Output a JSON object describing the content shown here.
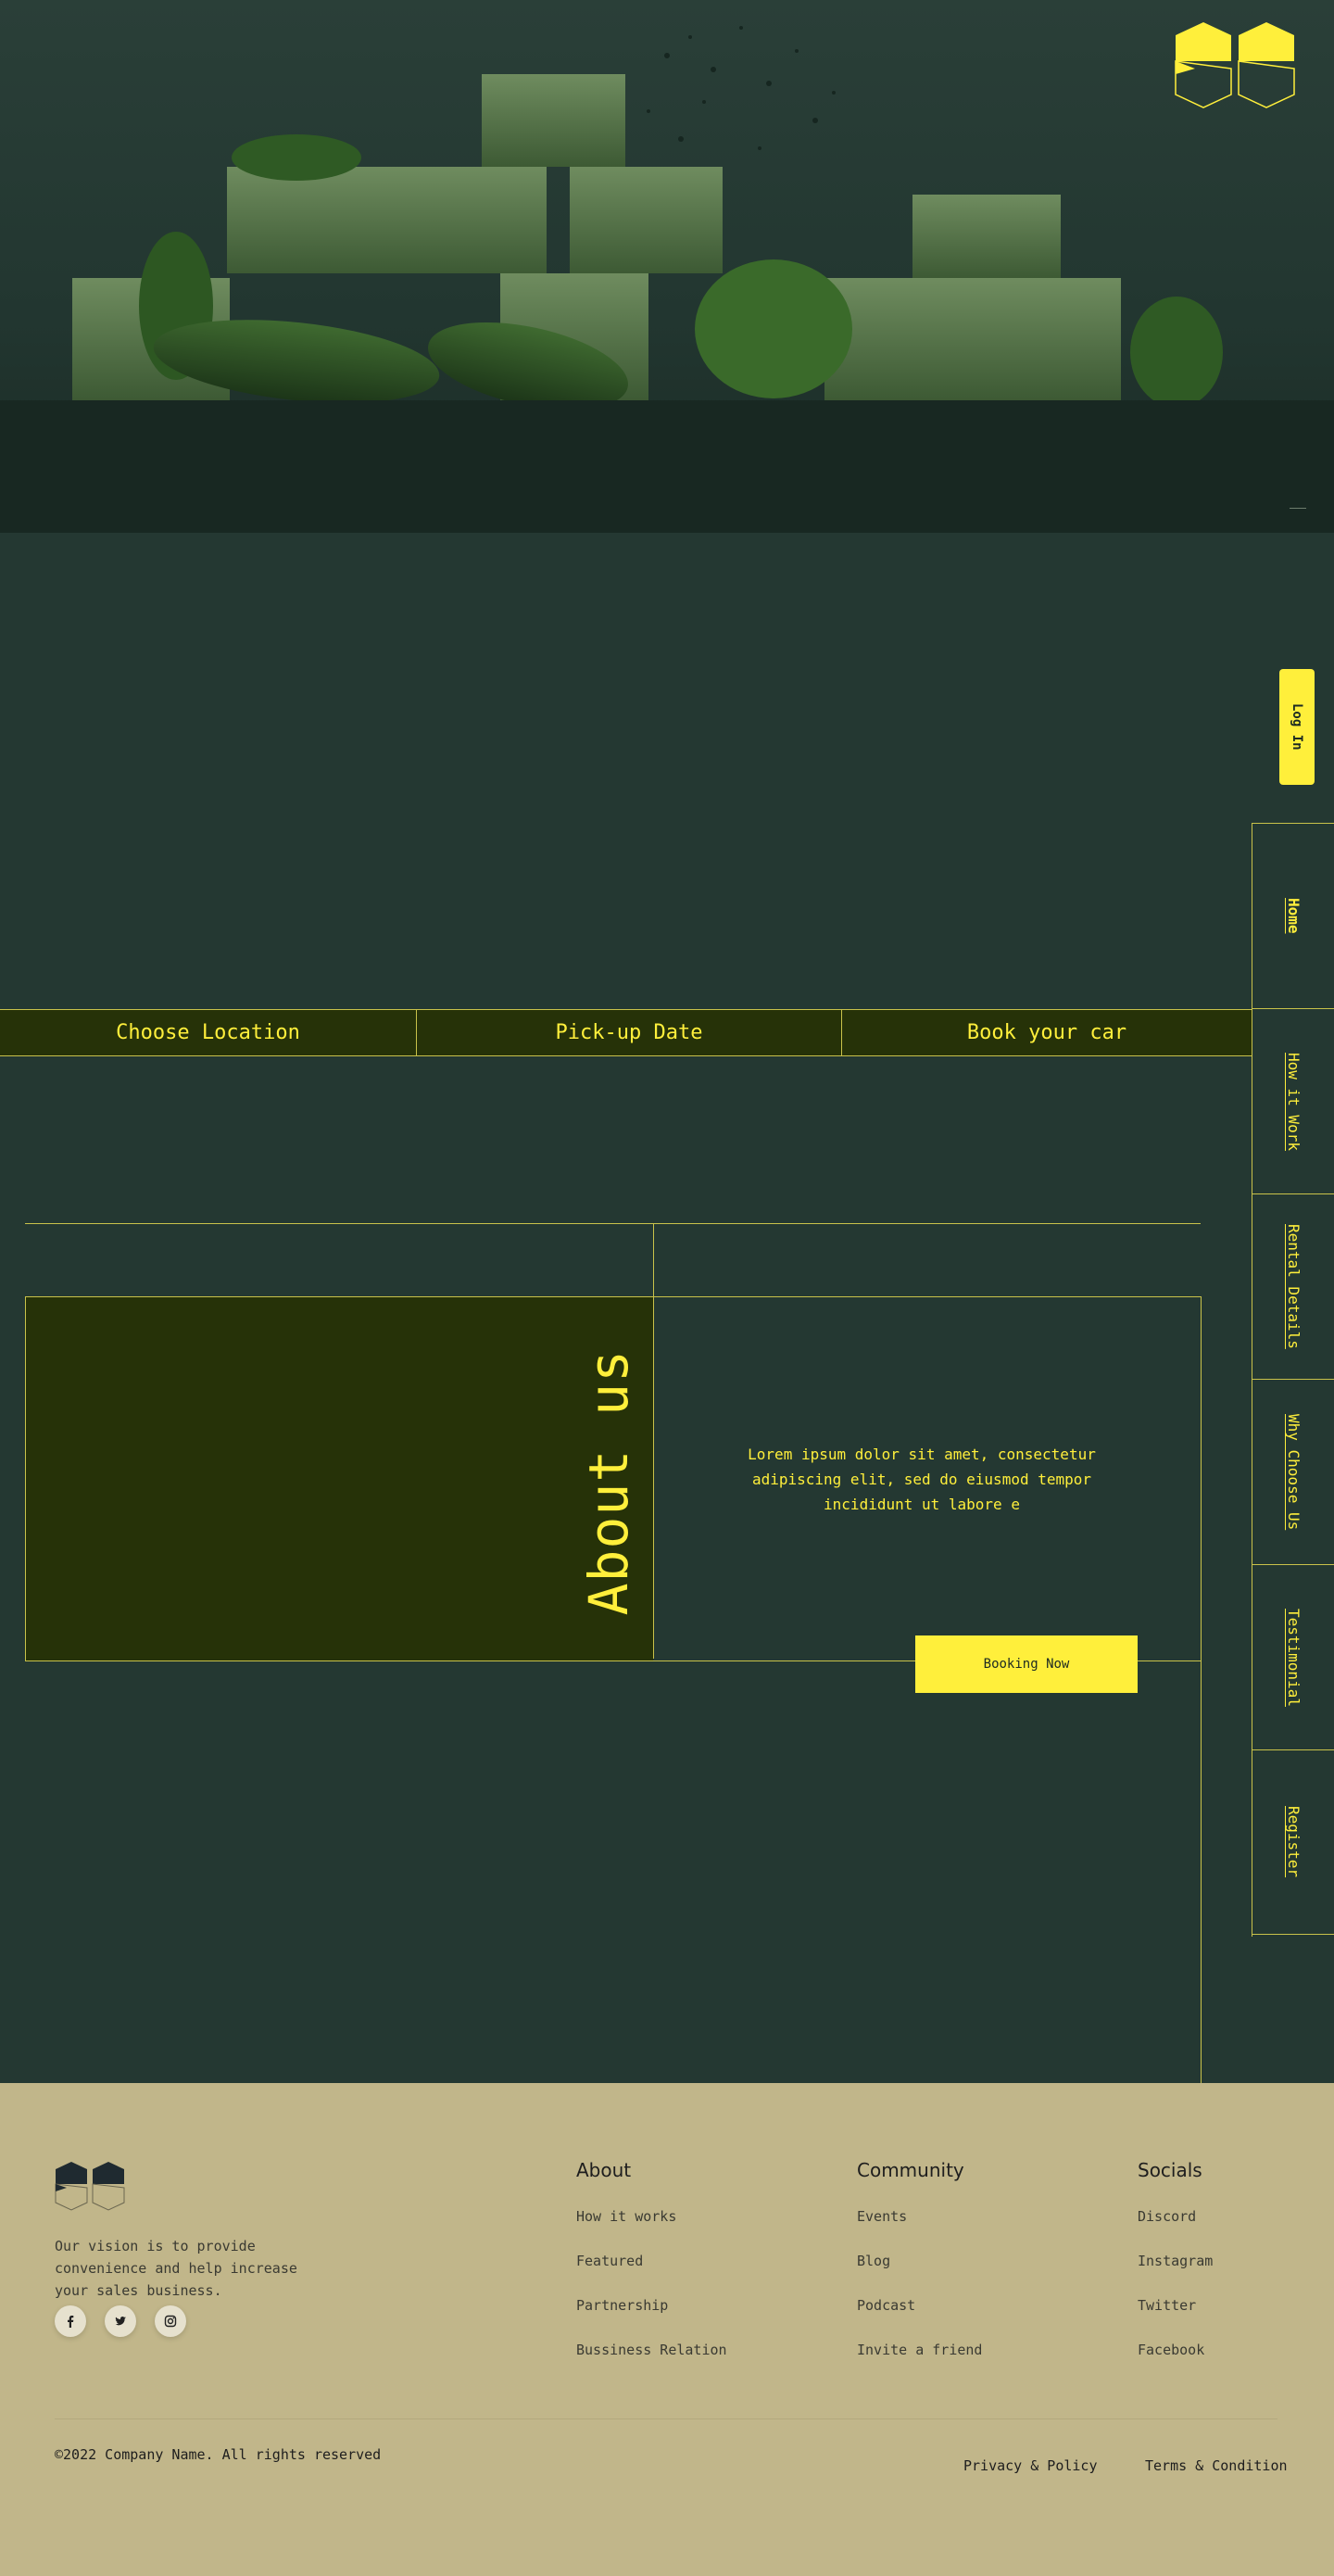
{
  "colors": {
    "accent": "#ffef3b",
    "background": "#243832",
    "panel": "#263208",
    "footer": "#c1b68a"
  },
  "header": {
    "logo_icon": "hexagon-logo-icon",
    "login_label": "Log In"
  },
  "side_nav": {
    "items": [
      {
        "label": "Home"
      },
      {
        "label": "How it Work"
      },
      {
        "label": "Rental Details"
      },
      {
        "label": "Why Choose Us"
      },
      {
        "label": "Testimonial"
      },
      {
        "label": "Register"
      }
    ]
  },
  "booking_bar": {
    "location": "Choose Location",
    "date": "Pick-up Date",
    "book": "Book your car"
  },
  "about": {
    "title": "About us",
    "body": "Lorem ipsum dolor sit amet, consectetur adipiscing elit, sed do eiusmod tempor incididunt ut labore e",
    "button": "Booking Now"
  },
  "footer": {
    "vision": "Our vision is to provide convenience and help increase your sales business.",
    "social_icons": [
      "facebook-icon",
      "twitter-icon",
      "instagram-icon"
    ],
    "columns": [
      {
        "title": "About",
        "links": [
          "How it works",
          "Featured",
          "Partnership",
          "Bussiness Relation"
        ]
      },
      {
        "title": "Community",
        "links": [
          "Events",
          "Blog",
          "Podcast",
          "Invite a friend"
        ]
      },
      {
        "title": "Socials",
        "links": [
          "Discord",
          "Instagram",
          "Twitter",
          "Facebook"
        ]
      }
    ],
    "copyright": "©2022 Company Name. All rights reserved",
    "privacy": "Privacy & Policy",
    "terms": "Terms & Condition"
  }
}
